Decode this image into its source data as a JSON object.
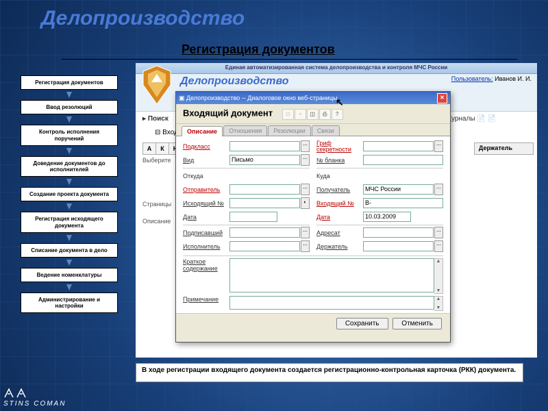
{
  "slide": {
    "title": "Делопроизводство",
    "subtitle": "Регистрация документов",
    "caption": "В ходе регистрации входящего документа создается регистрационно-контрольная карточка (РКК) документа.",
    "footer_logo": "STINS  COMAN"
  },
  "sidebar": {
    "steps": [
      "Регистрация документов",
      "Ввод резолюций",
      "Контроль исполнения поручений",
      "Доведение документов до исполнителей",
      "Создание проекта документа",
      "Регистрация исходящего документа",
      "Списание документа в дело",
      "Ведение номенклатуры",
      "Администрирование и настройки"
    ]
  },
  "app": {
    "top_bar": "Единая автоматизированная система делопроизводства и контроля МЧС России",
    "logo_text": "Делопроизводство",
    "user_label": "Пользователь:",
    "user_name": "Иванов И. И.",
    "search_header": "Поиск",
    "journals_label": "Журналы",
    "vhod": "Вход",
    "alpha": [
      "А",
      "К",
      "Н"
    ],
    "vyberite": "Выберите",
    "table_col": "Держатель",
    "pages": "Страницы",
    "opis": "Описание"
  },
  "modal": {
    "titlebar": "Делопроизводство -- Диалоговое окно веб-страницы",
    "header": "Входящий документ",
    "tabs": [
      "Описание",
      "Отношения",
      "Резолюции",
      "Связи"
    ],
    "left": {
      "podklass": "Подкласс",
      "vid": "Вид",
      "vid_val": "Письмо",
      "otkuda": "Откуда",
      "otprav": "Отправитель",
      "ish_no": "Исходящий №",
      "data": "Дата",
      "podpis": "Подписавший",
      "ispoln": "Исполнитель"
    },
    "right": {
      "grif": "Гриф секретности",
      "blank": "№ бланка",
      "kuda": "Куда",
      "poluch": "Получатель",
      "poluch_val": "МЧС России",
      "vh_no": "Входящий №",
      "vh_val": "В-",
      "data": "Дата",
      "data_val": "10.03.2009",
      "adresat": "Адресат",
      "derzh": "Держатель"
    },
    "kratk": "Краткое содержание",
    "prim": "Примечание",
    "save": "Сохранить",
    "cancel": "Отменить"
  }
}
